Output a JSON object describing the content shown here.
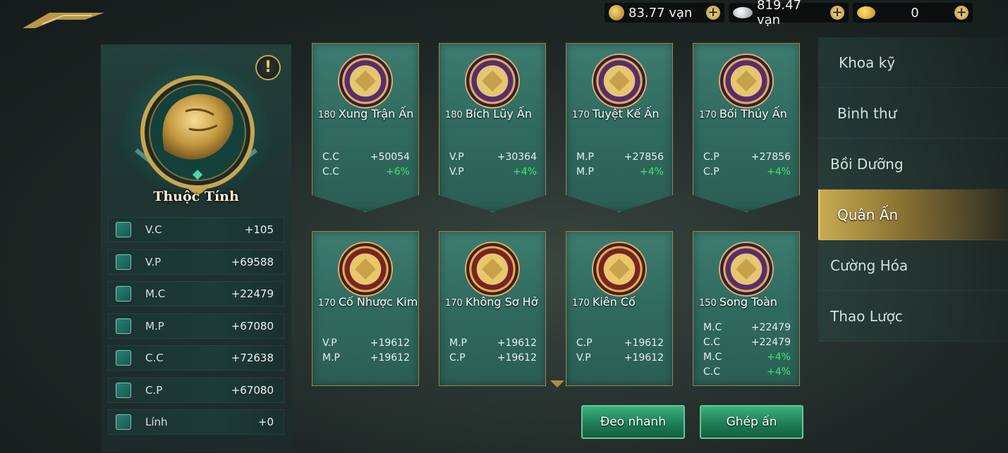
{
  "currency": [
    {
      "icon": "coin-bag-icon",
      "value": "83.77 vạn"
    },
    {
      "icon": "silver-ingot-icon",
      "value": "819.47 vạn"
    },
    {
      "icon": "gold-ingot-icon",
      "value": "0"
    }
  ],
  "left": {
    "title": "Thuộc Tính",
    "info_symbol": "!",
    "stats": [
      {
        "label": "V.C",
        "value": "+105"
      },
      {
        "label": "V.P",
        "value": "+69588"
      },
      {
        "label": "M.C",
        "value": "+22479"
      },
      {
        "label": "M.P",
        "value": "+67080"
      },
      {
        "label": "C.C",
        "value": "+72638"
      },
      {
        "label": "C.P",
        "value": "+67080"
      },
      {
        "label": "Lính",
        "value": "+0"
      }
    ]
  },
  "cards": [
    {
      "level": "180",
      "name": "Xung Trận Ấn",
      "stats": [
        {
          "label": "C.C",
          "value": "+50054",
          "green": false
        },
        {
          "label": "C.C",
          "value": "+6%",
          "green": true
        }
      ]
    },
    {
      "level": "180",
      "name": "Bích Lũy Ấn",
      "stats": [
        {
          "label": "V.P",
          "value": "+30364",
          "green": false
        },
        {
          "label": "V.P",
          "value": "+4%",
          "green": true
        }
      ]
    },
    {
      "level": "170",
      "name": "Tuyệt Kế Ấn",
      "stats": [
        {
          "label": "M.P",
          "value": "+27856",
          "green": false
        },
        {
          "label": "M.P",
          "value": "+4%",
          "green": true
        }
      ]
    },
    {
      "level": "170",
      "name": "Bối Thủy Ấn",
      "stats": [
        {
          "label": "C.P",
          "value": "+27856",
          "green": false
        },
        {
          "label": "C.P",
          "value": "+4%",
          "green": true
        }
      ]
    },
    {
      "level": "170",
      "name": "Cố Nhược Kim",
      "stats": [
        {
          "label": "V.P",
          "value": "+19612",
          "green": false
        },
        {
          "label": "M.P",
          "value": "+19612",
          "green": false
        }
      ]
    },
    {
      "level": "170",
      "name": "Không Sơ Hở",
      "stats": [
        {
          "label": "M.P",
          "value": "+19612",
          "green": false
        },
        {
          "label": "C.P",
          "value": "+19612",
          "green": false
        }
      ]
    },
    {
      "level": "170",
      "name": "Kiên Cố",
      "stats": [
        {
          "label": "C.P",
          "value": "+19612",
          "green": false
        },
        {
          "label": "V.P",
          "value": "+19612",
          "green": false
        }
      ]
    },
    {
      "level": "150",
      "name": "Song Toàn",
      "stats": [
        {
          "label": "M.C",
          "value": "+22479",
          "green": false
        },
        {
          "label": "C.C",
          "value": "+22479",
          "green": false
        },
        {
          "label": "M.C",
          "value": "+4%",
          "green": true
        },
        {
          "label": "C.C",
          "value": "+4%",
          "green": true
        }
      ]
    }
  ],
  "nav": [
    {
      "label": "Khoa kỹ",
      "active": false
    },
    {
      "label": "Binh thư",
      "active": false
    },
    {
      "label": "Bồi Dưỡng",
      "active": false
    },
    {
      "label": "Quân Ấn",
      "active": true
    },
    {
      "label": "Cường Hóa",
      "active": false
    },
    {
      "label": "Thao Lược",
      "active": false
    }
  ],
  "buttons": {
    "quick_equip": "Đeo nhanh",
    "combine": "Ghép ấn"
  }
}
